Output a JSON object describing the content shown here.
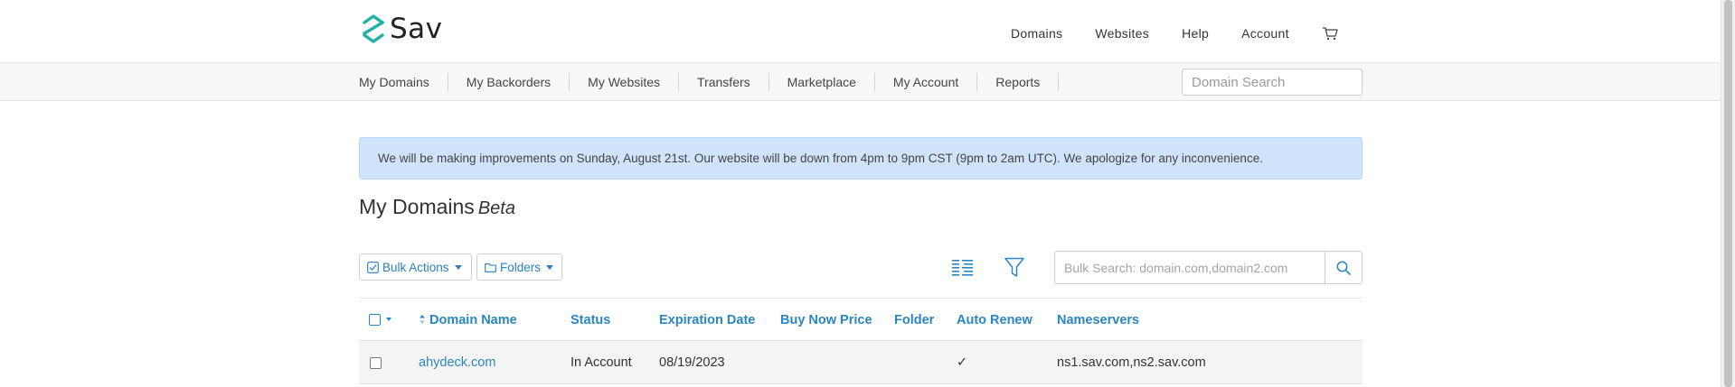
{
  "brand": {
    "name": "Sav"
  },
  "top_nav": {
    "items": [
      "Domains",
      "Websites",
      "Help",
      "Account"
    ],
    "cart_icon": "cart-icon"
  },
  "sub_nav": {
    "items": [
      "My Domains",
      "My Backorders",
      "My Websites",
      "Transfers",
      "Marketplace",
      "My Account",
      "Reports"
    ]
  },
  "domain_search": {
    "placeholder": "Domain Search"
  },
  "alert": {
    "text": "We will be making improvements on Sunday, August 21st. Our website will be down from 4pm to 9pm CST (9pm to 2am UTC). We apologize for any inconvenience."
  },
  "page": {
    "title": "My Domains",
    "badge": "Beta"
  },
  "toolbar": {
    "bulk_actions_label": "Bulk Actions",
    "folders_label": "Folders",
    "bulk_search_placeholder": "Bulk Search: domain.com,domain2.com"
  },
  "table": {
    "columns": [
      "Domain Name",
      "Status",
      "Expiration Date",
      "Buy Now Price",
      "Folder",
      "Auto Renew",
      "Nameservers"
    ],
    "rows": [
      {
        "domain": "ahydeck.com",
        "status": "In Account",
        "expiration": "08/19/2023",
        "buy_now_price": "",
        "folder": "",
        "auto_renew": "✓",
        "nameservers": "ns1.sav.com,ns2.sav.com"
      }
    ]
  },
  "colors": {
    "accent": "#2a86c2",
    "alert_bg": "#cfe4fa",
    "logo_teal": "#1fb3a6"
  }
}
